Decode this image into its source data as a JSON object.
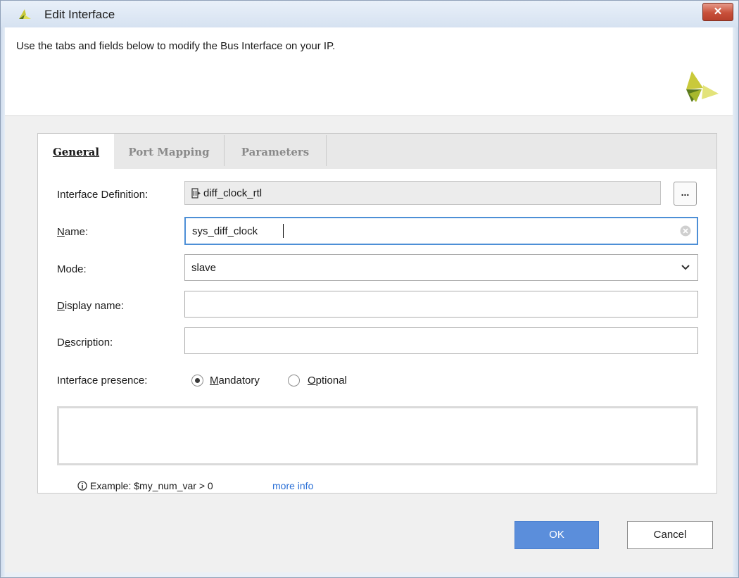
{
  "window": {
    "title": "Edit Interface",
    "close_glyph": "✕"
  },
  "header": {
    "text": "Use the tabs and fields below to modify the Bus Interface on your IP."
  },
  "tabs": [
    {
      "label": "General",
      "active": true
    },
    {
      "label": "Port Mapping",
      "active": false
    },
    {
      "label": "Parameters",
      "active": false
    }
  ],
  "form": {
    "interface_definition": {
      "label": "Interface Definition:",
      "value": "diff_clock_rtl",
      "browse_label": "..."
    },
    "name": {
      "label": "Name:",
      "value": "sys_diff_clock"
    },
    "mode": {
      "label": "Mode:",
      "value": "slave"
    },
    "display_name": {
      "label": "Display name:",
      "value": ""
    },
    "description": {
      "label": "Description:",
      "value": ""
    },
    "presence": {
      "label": "Interface presence:",
      "options": [
        "Mandatory",
        "Optional"
      ],
      "selected": "Mandatory"
    }
  },
  "hint": {
    "text": "Example:  $my_num_var > 0",
    "link": "more info"
  },
  "buttons": {
    "ok": "OK",
    "cancel": "Cancel"
  },
  "colors": {
    "accent": "#5b8edb",
    "focus_border": "#4d8fd6",
    "close_red": "#c8503a",
    "logo_yellow": "#c8c83a",
    "logo_green": "#5b7a1e"
  },
  "icons": {
    "app_logo": "vivado-logo-icon",
    "interface_def": "bus-interface-icon",
    "clear": "clear-field-icon",
    "dropdown": "chevron-down-icon",
    "info": "info-icon"
  }
}
